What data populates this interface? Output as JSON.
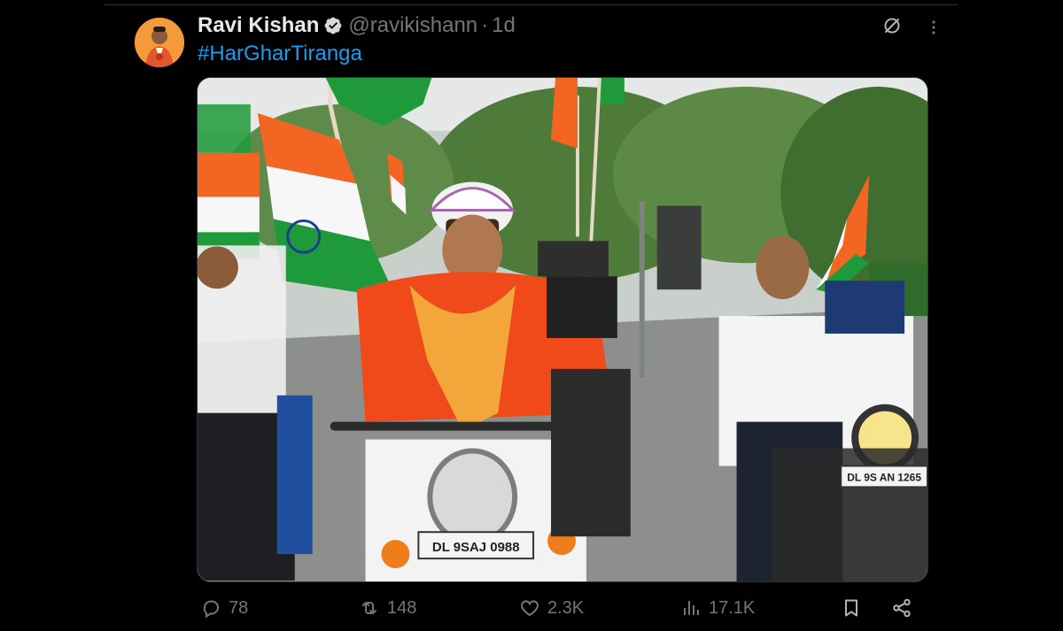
{
  "tweet": {
    "display_name": "Ravi Kishan",
    "handle": "@ravikishann",
    "separator": "·",
    "time": "1d",
    "text": "#HarGharTiranga"
  },
  "media": {
    "plate_center": "DL 9SAJ 0988",
    "plate_right": "DL 9S AN 1265"
  },
  "actions": {
    "replies": "78",
    "reposts": "148",
    "likes": "2.3K",
    "views": "17.1K"
  },
  "icons": {
    "verified": "verified-badge-icon",
    "grok": "grok-icon",
    "more": "more-icon",
    "reply": "reply-icon",
    "repost": "repost-icon",
    "like": "heart-icon",
    "views": "views-chart-icon",
    "bookmark": "bookmark-icon",
    "share": "share-icon"
  },
  "colors": {
    "background": "#000000",
    "text_primary": "#e7e9ea",
    "text_secondary": "#71767b",
    "link": "#1d9bf0",
    "saffron": "#ff6b1a",
    "india_green": "#138808"
  }
}
